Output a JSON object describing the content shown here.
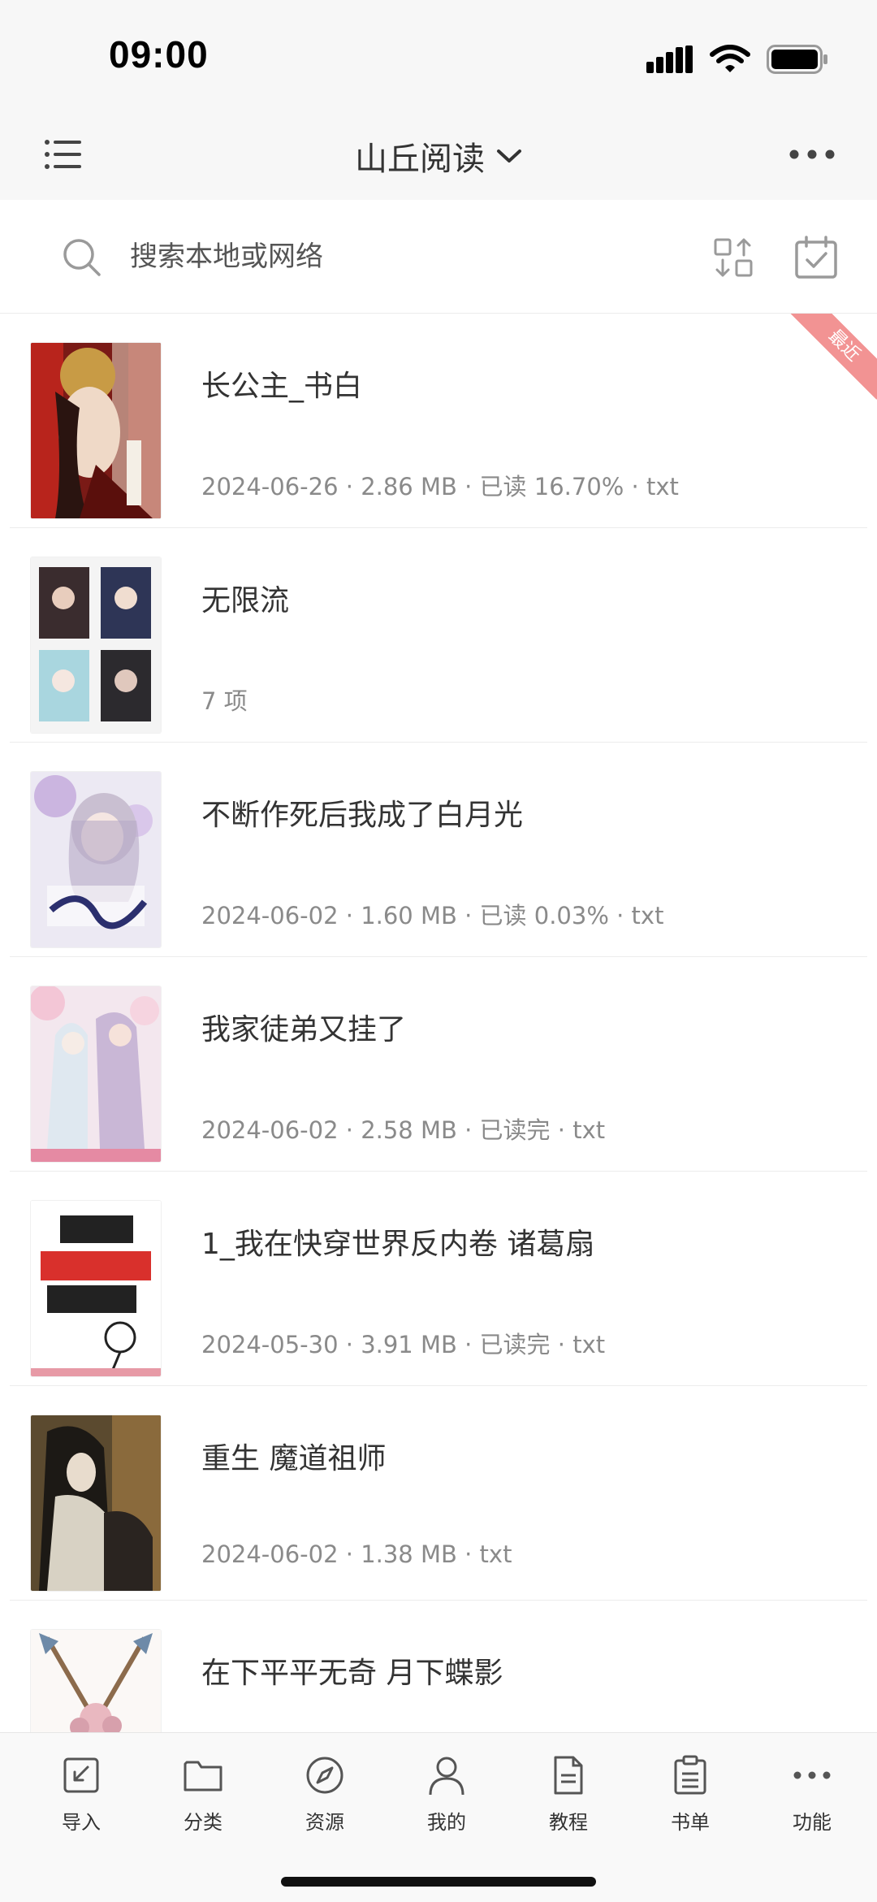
{
  "status_bar": {
    "time": "09:00"
  },
  "header": {
    "title": "山丘阅读"
  },
  "search": {
    "placeholder": "搜索本地或网络"
  },
  "books": [
    {
      "title": "长公主_书白",
      "meta": "2024-06-26 · 2.86 MB · 已读 16.70% · txt",
      "badge": "最近"
    },
    {
      "title": "无限流",
      "meta": "7 项"
    },
    {
      "title": "不断作死后我成了白月光",
      "meta": "2024-06-02 · 1.60 MB · 已读 0.03% · txt"
    },
    {
      "title": "我家徒弟又挂了",
      "meta": "2024-06-02 · 2.58 MB · 已读完 · txt"
    },
    {
      "title": "1_我在快穿世界反内卷 诸葛扇",
      "meta": "2024-05-30 · 3.91 MB · 已读完 · txt"
    },
    {
      "title": "重生 魔道祖师",
      "meta": "2024-06-02 · 1.38 MB · txt"
    },
    {
      "title": "在下平平无奇 月下蝶影",
      "meta": ""
    }
  ],
  "tabs": [
    {
      "label": "导入",
      "icon": "import-icon"
    },
    {
      "label": "分类",
      "icon": "folder-icon"
    },
    {
      "label": "资源",
      "icon": "compass-icon"
    },
    {
      "label": "我的",
      "icon": "user-icon"
    },
    {
      "label": "教程",
      "icon": "document-icon"
    },
    {
      "label": "书单",
      "icon": "clipboard-icon"
    },
    {
      "label": "功能",
      "icon": "more-icon"
    }
  ],
  "colors": {
    "accent_ribbon": "#f29393",
    "text_primary": "#333333",
    "text_secondary": "#8a8a8a"
  }
}
